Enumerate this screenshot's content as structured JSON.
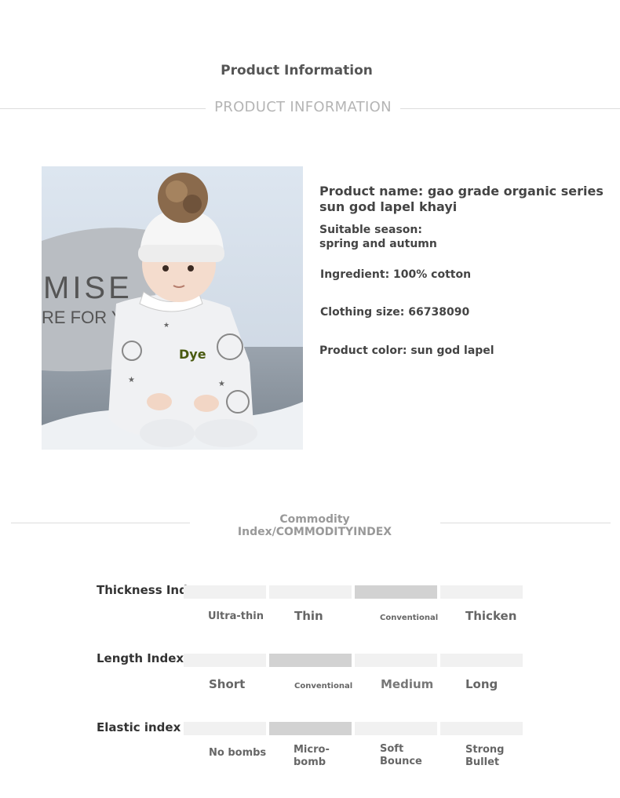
{
  "header": {
    "title": "Product Information",
    "subtitle": "PRODUCT INFORMATION"
  },
  "product": {
    "image_overlay_text": "Dye",
    "pillow_text_line1": "MISE",
    "pillow_text_line2": "RE  FOR YOU",
    "name": "Product name: gao grade organic series sun god lapel khayi",
    "season_label": "Suitable season:",
    "season_value": "spring and autumn",
    "ingredient": "Ingredient: 100% cotton",
    "size": "Clothing size: 66738090",
    "color": "Product color: sun god lapel"
  },
  "commodity": {
    "heading": "Commodity Index/COMMODITYINDEX",
    "indexes": [
      {
        "label": "Thickness Index",
        "active": 2,
        "options": [
          "Ultra-thin",
          "Thin",
          "Conventional",
          "Thicken"
        ]
      },
      {
        "label": "Length Index",
        "active": 1,
        "options": [
          "Short",
          "Conventional",
          "Medium",
          "Long"
        ]
      },
      {
        "label": "Elastic index",
        "active": 1,
        "options": [
          "No bombs",
          "Micro-\nbomb",
          "Soft\nBounce",
          "Strong\nBullet"
        ]
      }
    ]
  },
  "colors": {
    "title_text": "#555555",
    "subtitle_text": "#b5b5b5",
    "bar_inactive": "#f1f1f1",
    "bar_active": "#d2d2d2",
    "dye_text": "#4a5a10"
  }
}
